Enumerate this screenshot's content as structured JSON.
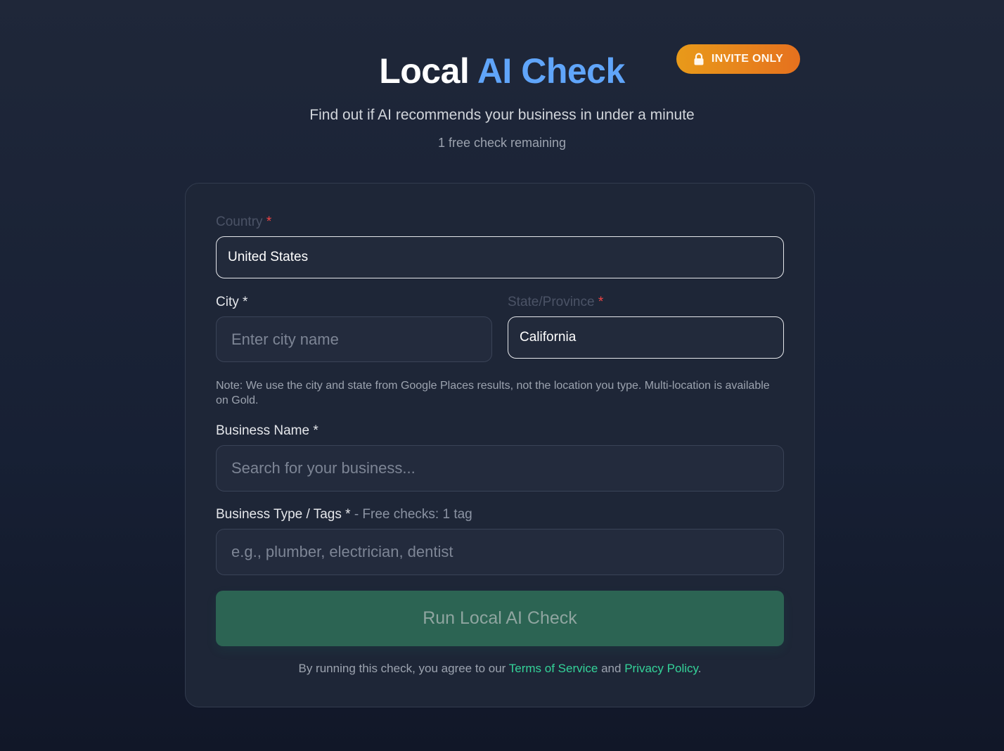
{
  "header": {
    "title_part1": "Local",
    "title_part2": "AI Check",
    "badge": "INVITE ONLY",
    "badge_icon": "lock-icon",
    "subtitle": "Find out if AI recommends your business in under a minute",
    "remaining": "1 free check remaining"
  },
  "form": {
    "country": {
      "label": "Country",
      "required_mark": "*",
      "value": "United States"
    },
    "city": {
      "label": "City",
      "required_mark": "*",
      "placeholder": "Enter city name"
    },
    "state": {
      "label": "State/Province",
      "required_mark": "*",
      "value": "California"
    },
    "note": "Note: We use the city and state from Google Places results, not the location you type. Multi-location is available on Gold.",
    "business_name": {
      "label": "Business Name",
      "required_mark": "*",
      "placeholder": "Search for your business..."
    },
    "business_type": {
      "label": "Business Type / Tags",
      "required_mark": "*",
      "hint": "- Free checks: 1 tag",
      "placeholder": "e.g., plumber, electrician, dentist"
    },
    "submit_label": "Run Local AI Check",
    "terms": {
      "prefix": "By running this check, you agree to our",
      "tos": "Terms of Service",
      "and": "and",
      "privacy": "Privacy Policy",
      "suffix": "."
    }
  },
  "colors": {
    "accent_blue": "#60a5fa",
    "badge_orange": "#e6711e",
    "button_green": "#2c6453",
    "link_green": "#34d399",
    "required_red": "#ef4444"
  }
}
